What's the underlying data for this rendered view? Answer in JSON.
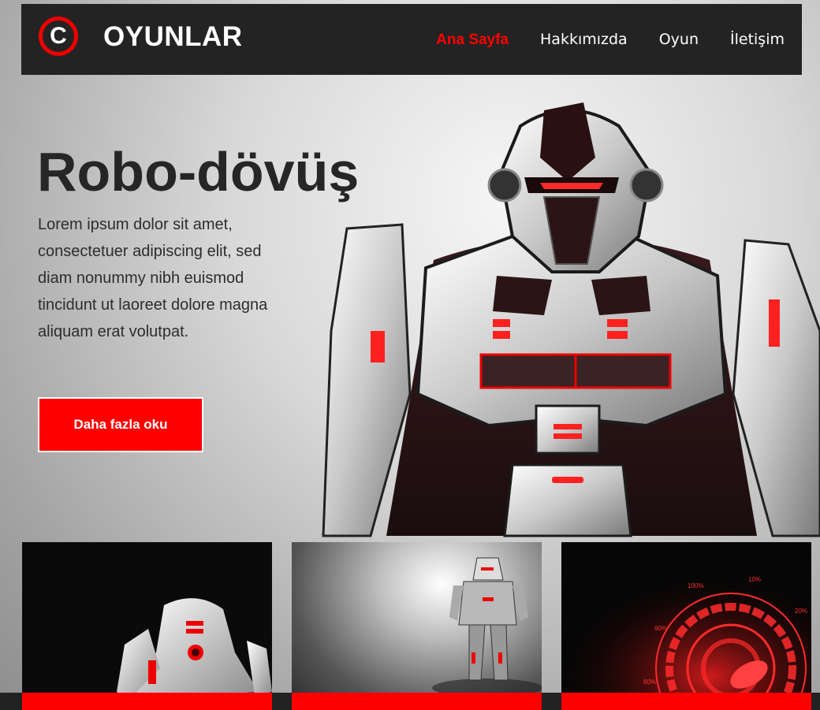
{
  "brand": {
    "logo_letter": "C",
    "name": "OYUNLAR"
  },
  "nav": {
    "items": [
      {
        "label": "Ana Sayfa",
        "active": true
      },
      {
        "label": "Hakkımızda",
        "active": false
      },
      {
        "label": "Oyun",
        "active": false
      },
      {
        "label": "İletişim",
        "active": false
      }
    ]
  },
  "hero": {
    "title": "Robo-dövüş",
    "text": "Lorem ipsum dolor sit amet, consectetuer adipiscing elit, sed diam nonummy nibh euismod tincidunt ut laoreet dolore magna aliquam erat volutpat.",
    "button": "Daha fazla oku"
  },
  "radar_labels": [
    "100%",
    "10%",
    "20%",
    "90%",
    "80%"
  ],
  "colors": {
    "accent": "#ff0000",
    "header": "#232323",
    "title": "#262626"
  }
}
